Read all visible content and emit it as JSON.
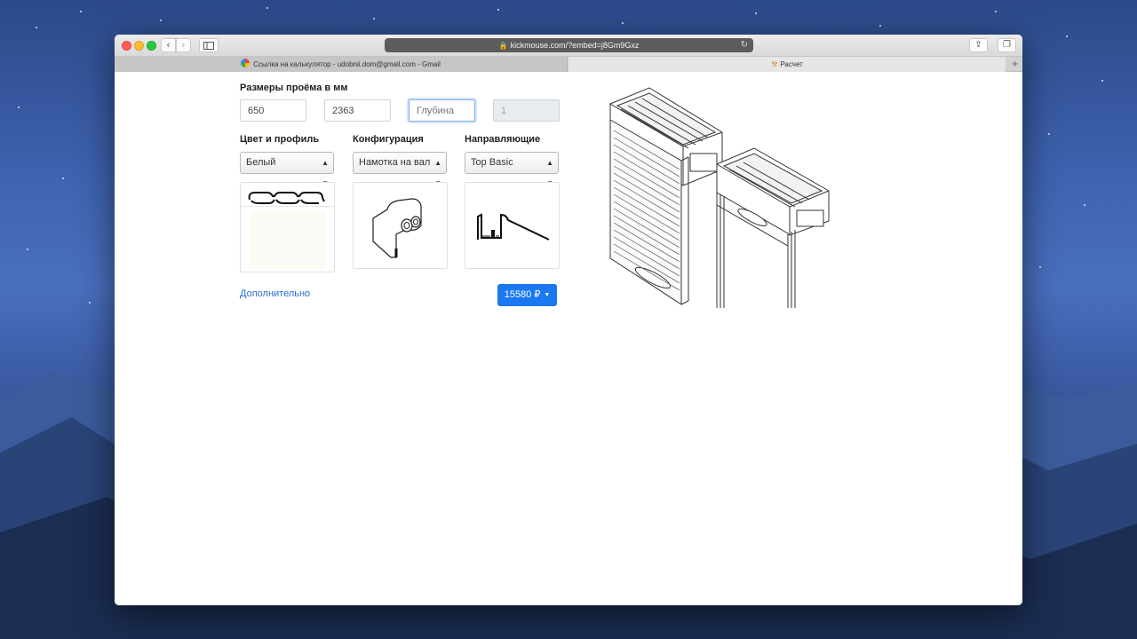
{
  "browser": {
    "url": "kickmouse.com/?embed=j8Gm9Gxz",
    "tabs": [
      {
        "title": "Ссылка на калькулятор - udobnii.dom@gmail.com - Gmail",
        "icon": "google-icon"
      },
      {
        "title": "Расчет",
        "icon": "tool-icon"
      }
    ]
  },
  "form": {
    "dimensions_title": "Размеры проёма в мм",
    "width_value": "650",
    "height_value": "2363",
    "depth_placeholder": "Глубина",
    "quantity_value": "1",
    "color_label": "Цвет и профиль",
    "color_selected": "Белый",
    "config_label": "Конфигурация",
    "config_selected": "Намотка на вал",
    "guides_label": "Направляющие",
    "guides_selected": "Top Basic",
    "more_link": "Дополнительно",
    "price": "15580 ₽"
  },
  "colors": {
    "accent": "#1a78f0",
    "link": "#2a6fd4",
    "swatch": "#fbfbf6"
  }
}
